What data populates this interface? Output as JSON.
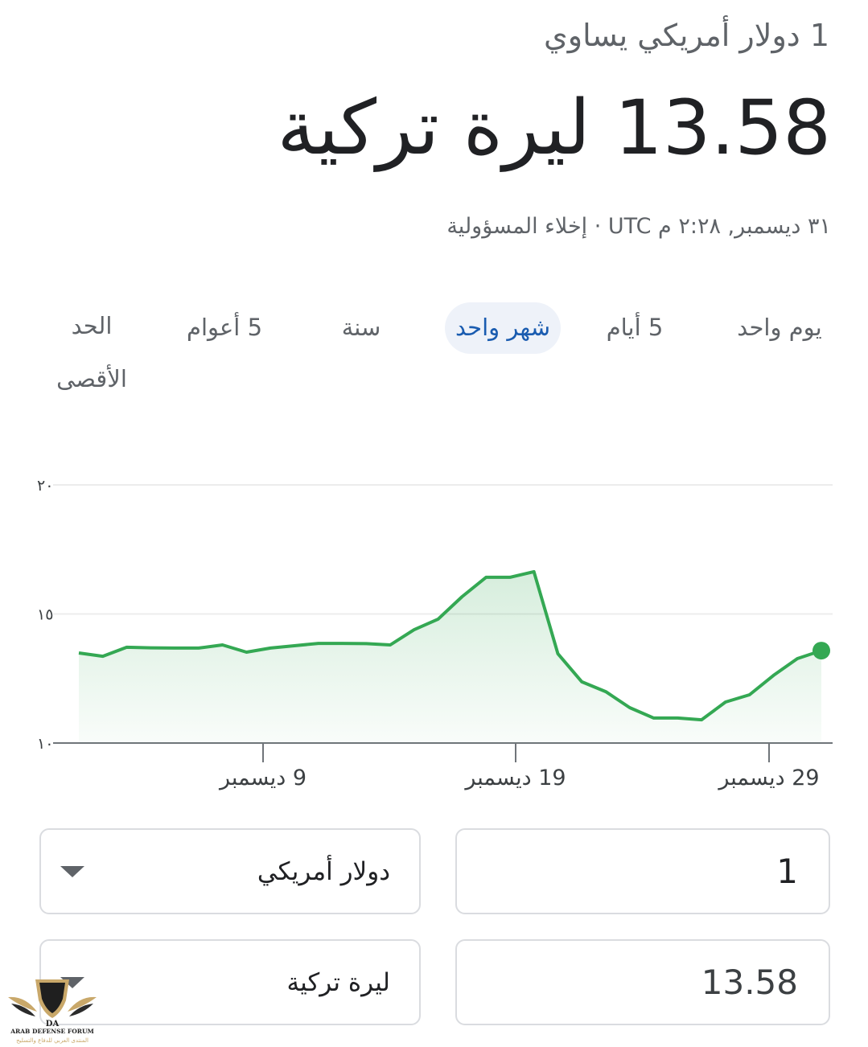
{
  "header": {
    "subtitle": "1 دولار أمريكي يساوي",
    "rate": "13.58 ليرة تركية",
    "timestamp": "٣١ ديسمبر, ٢:٢٨ م UTC",
    "separator": " · ",
    "disclaimer": "إخلاء المسؤولية"
  },
  "tabs": [
    {
      "label": "يوم واحد",
      "selected": false
    },
    {
      "label": "5 أيام",
      "selected": false
    },
    {
      "label": "شهر واحد",
      "selected": true
    },
    {
      "label": "سنة",
      "selected": false
    },
    {
      "label": "5 أعوام",
      "selected": false
    },
    {
      "label": "الحد الأقصى",
      "selected": false
    }
  ],
  "chart_data": {
    "type": "area",
    "ylim": [
      10,
      20
    ],
    "y_ticks": [
      "١٠",
      "١٥",
      "٢٠"
    ],
    "y_tick_values": [
      10,
      15,
      20
    ],
    "x_ticks": [
      "9 ديسمبر",
      "19 ديسمبر",
      "29 ديسمبر"
    ],
    "grid": true,
    "line_color": "#34a853",
    "values": [
      13.49,
      13.36,
      13.71,
      13.69,
      13.68,
      13.68,
      13.8,
      13.52,
      13.68,
      13.77,
      13.86,
      13.86,
      13.85,
      13.8,
      14.39,
      14.8,
      15.67,
      16.42,
      16.42,
      16.64,
      13.46,
      12.37,
      11.99,
      11.37,
      10.97,
      10.97,
      10.9,
      11.59,
      11.87,
      12.62,
      13.27,
      13.58
    ]
  },
  "converter": {
    "from_amount": "1",
    "from_currency": "دولار أمريكي",
    "to_amount": "13.58",
    "to_currency": "ليرة تركية"
  },
  "logo": {
    "text_en": "ARAB DEFENSE FORUM",
    "text_ar": "المنتدى العربي للدفاع والتسليح",
    "mark": "DA"
  },
  "colors": {
    "accent": "#1a5cb0",
    "tab_selected_bg": "#eef2f9",
    "line": "#34a853"
  }
}
